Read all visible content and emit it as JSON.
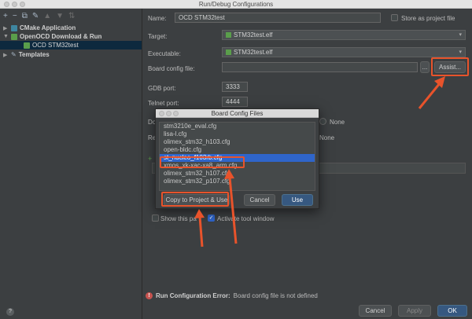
{
  "window": {
    "title": "Run/Debug Configurations"
  },
  "toolbar": {
    "icons": [
      "plus-icon",
      "minus-icon",
      "copy-icon",
      "wrench-icon",
      "move-up-icon",
      "move-down-icon",
      "sort-icon"
    ]
  },
  "tree": {
    "items": [
      {
        "label": "CMake Application"
      },
      {
        "label": "OpenOCD Download & Run"
      },
      {
        "label": "OCD STM32test"
      },
      {
        "label": "Templates"
      }
    ]
  },
  "form": {
    "name_label": "Name:",
    "name_value": "OCD STM32test",
    "store_label": "Store as project file",
    "target_label": "Target:",
    "target_value": "STM32test.elf",
    "executable_label": "Executable:",
    "executable_value": "STM32test.elf",
    "board_label": "Board config file:",
    "board_value": "",
    "browse_label": "...",
    "assist_label": "Assist...",
    "gdb_label": "GDB port:",
    "gdb_value": "3333",
    "telnet_label": "Telnet port:",
    "telnet_value": "4444",
    "download_label": "Do",
    "reset_label": "Re",
    "none_label_1": "None",
    "none_label_2": "None",
    "show_page_label": "Show this pa",
    "activate_label": "Activate tool window"
  },
  "dialog": {
    "title": "Board Config Files",
    "items": [
      "stm3210e_eval.cfg",
      "lisa-l.cfg",
      "olimex_stm32_h103.cfg",
      "open-bldc.cfg",
      "st_nucleo_f103rb.cfg",
      "xmos_xk-xac-xa8_arm.cfg",
      "olimex_stm32_h107.cfg",
      "olimex_stm32_p107.cfg"
    ],
    "selected_index": 4,
    "copy_label": "Copy to Project & Use",
    "cancel_label": "Cancel",
    "use_label": "Use"
  },
  "error": {
    "title": "Run Configuration Error:",
    "message": "Board config file is not defined"
  },
  "footer": {
    "help_label": "?",
    "cancel_label": "Cancel",
    "apply_label": "Apply",
    "ok_label": "OK"
  },
  "colors": {
    "highlight": "#e8532b",
    "selection": "#2f65ca",
    "primary": "#365880"
  }
}
